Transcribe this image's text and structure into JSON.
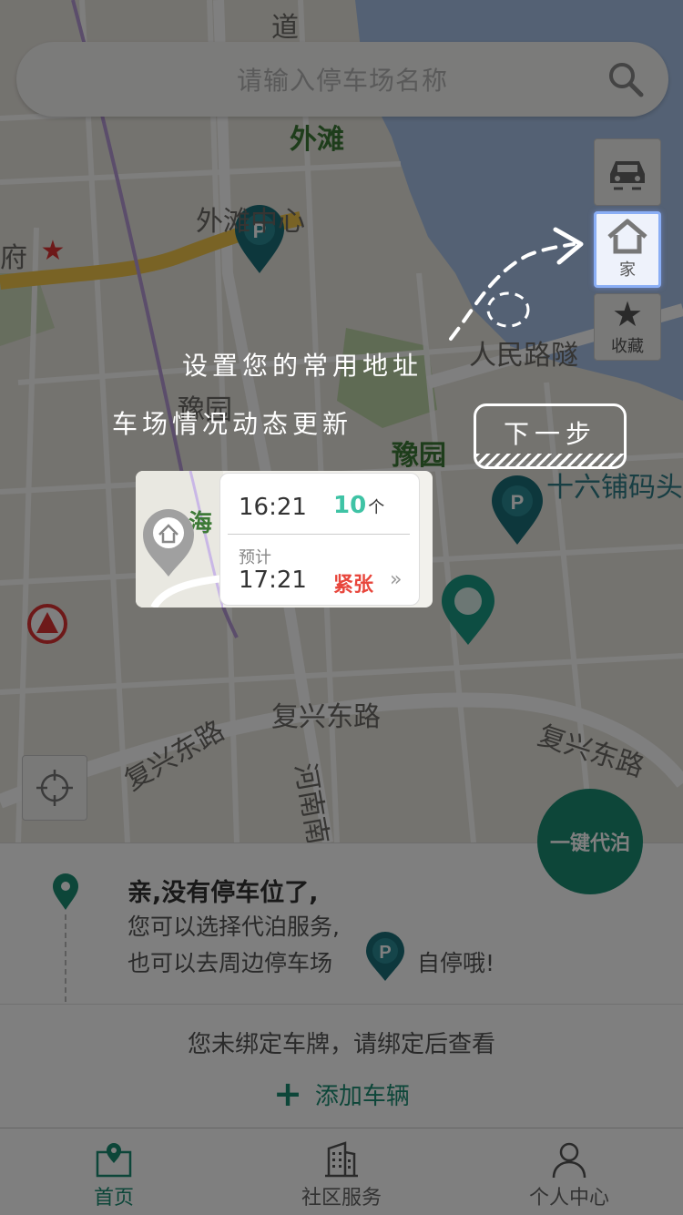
{
  "map": {
    "labels": {
      "daodao": "道",
      "waitan": "外滩",
      "waitan_center": "外滩中心",
      "fu": "府",
      "renmin_road": "人民路隧",
      "yuyuan_metro": "豫园",
      "yuyuan": "豫园",
      "shiliupu": "十六铺码头",
      "hai": "海",
      "fuxing_east_1": "复兴东路",
      "fuxing_east_2": "复兴东路",
      "fuxing_east_3": "复兴东路",
      "henan": "河南南"
    }
  },
  "search": {
    "placeholder": "请输入停车场名称"
  },
  "side_buttons": {
    "home_label": "家",
    "favorites_label": "收藏"
  },
  "valet_button": {
    "label": "一键代泊"
  },
  "guide": {
    "hint_1": "设置您的常用地址",
    "hint_2": "车场情况动态更新",
    "next_label": "下一步"
  },
  "info_card": {
    "current_time": "16:21",
    "spaces_count": "10",
    "spaces_unit": "个",
    "estimate_label": "预计",
    "estimate_time": "17:21",
    "status": "紧张",
    "chevron": "»"
  },
  "panel": {
    "title": "亲,没有停车位了,",
    "line1": "您可以选择代泊服务,",
    "line2_prefix": "也可以去周边停车场",
    "line2_suffix": "自停哦!",
    "unbound_text": "您未绑定车牌，请绑定后查看",
    "add_vehicle_label": "添加车辆",
    "add_symbol": "+"
  },
  "tabbar": {
    "tabs": [
      {
        "label": "首页",
        "icon": "home-map-icon",
        "active": true
      },
      {
        "label": "社区服务",
        "icon": "building-icon",
        "active": false
      },
      {
        "label": "个人中心",
        "icon": "person-icon",
        "active": false
      }
    ]
  },
  "colors": {
    "accent": "#1a8c72",
    "count": "#3fc3a5",
    "status_tight": "#e8463c",
    "water": "#a9c3e8",
    "highlight_border": "#8aaef5"
  }
}
